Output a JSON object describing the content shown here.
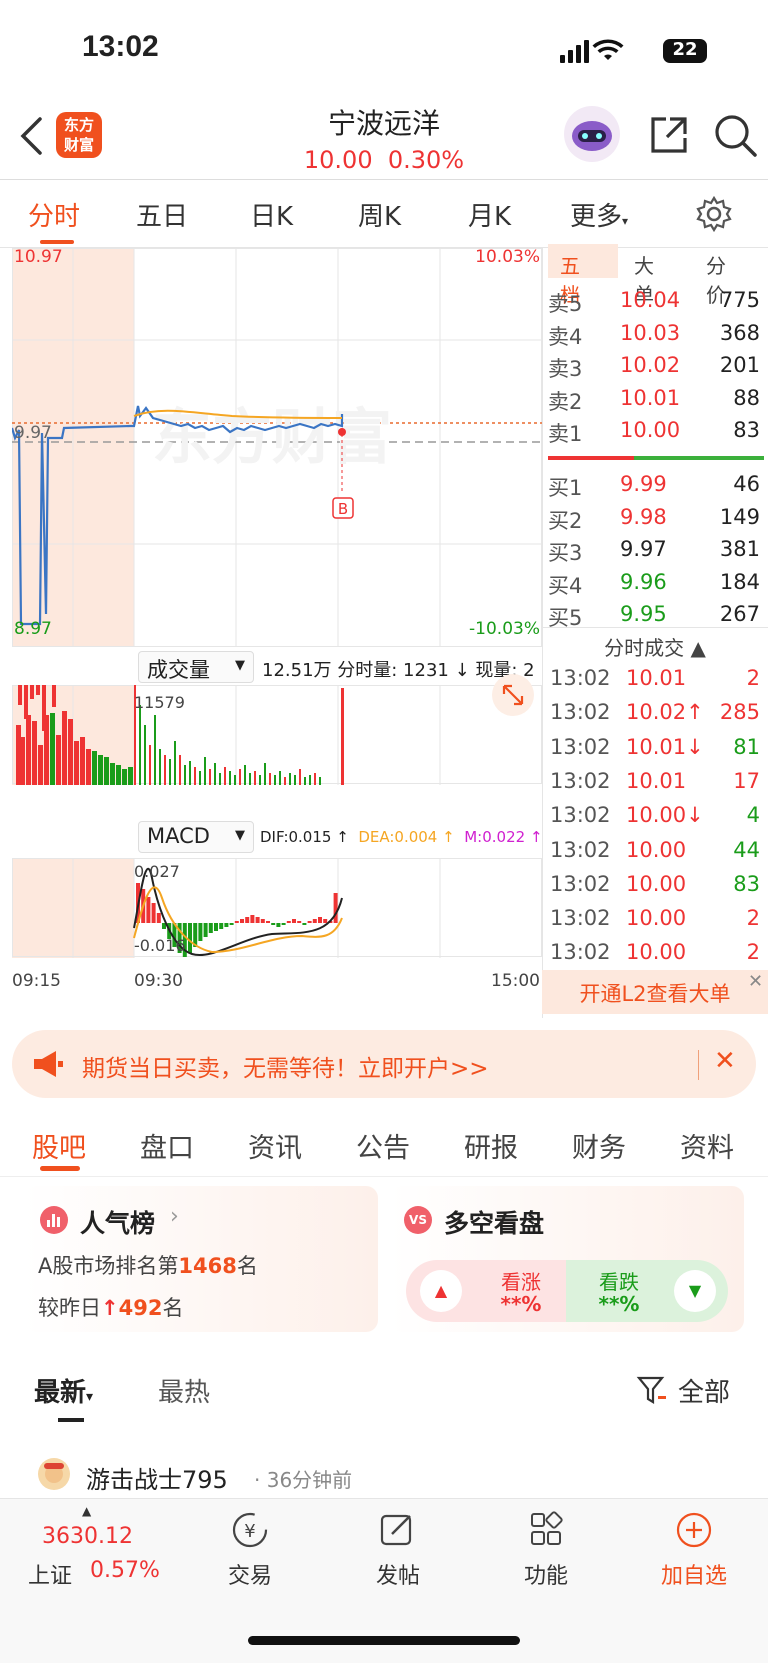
{
  "status": {
    "time": "13:02",
    "battery": "22"
  },
  "header": {
    "logo_line1": "东方",
    "logo_line2": "财富",
    "title": "宁波远洋",
    "price": "10.00",
    "change": "0.30%"
  },
  "tabs": [
    "分时",
    "五日",
    "日K",
    "周K",
    "月K",
    "更多"
  ],
  "chart": {
    "high_label": "10.97",
    "high_pct": "10.03%",
    "mid_label": "9.97",
    "low_label": "8.97",
    "low_pct": "-10.03%",
    "marker": "B",
    "volume_selector": "成交量",
    "volume_info": "12.51万 分时量: 1231 ↓ 现量: 2",
    "volume_max": "11579",
    "macd_selector": "MACD",
    "macd_dif": "DIF:0.015 ↑",
    "macd_dea": "DEA:0.004 ↑",
    "macd_m": "M:0.022 ↑",
    "macd_top": "0.027",
    "macd_bottom": "-0.016",
    "time_start": "09:15",
    "time_open": "09:30",
    "time_end": "15:00",
    "colors": {
      "price": "#3b75c4",
      "avg": "#f5a623",
      "up": "#e33",
      "down": "#1a9c1a"
    }
  },
  "book": {
    "tabs": [
      "五档",
      "大单",
      "分价"
    ],
    "asks": [
      {
        "label": "卖5",
        "price": "10.04",
        "vol": "775"
      },
      {
        "label": "卖4",
        "price": "10.03",
        "vol": "368"
      },
      {
        "label": "卖3",
        "price": "10.02",
        "vol": "201"
      },
      {
        "label": "卖2",
        "price": "10.01",
        "vol": "88"
      },
      {
        "label": "卖1",
        "price": "10.00",
        "vol": "83"
      }
    ],
    "bids": [
      {
        "label": "买1",
        "price": "9.99",
        "vol": "46"
      },
      {
        "label": "买2",
        "price": "9.98",
        "vol": "149"
      },
      {
        "label": "买3",
        "price": "9.97",
        "vol": "381"
      },
      {
        "label": "买4",
        "price": "9.96",
        "vol": "184"
      },
      {
        "label": "买5",
        "price": "9.95",
        "vol": "267"
      }
    ],
    "trades_title": "分时成交 ▲",
    "trades": [
      {
        "t": "13:02",
        "p": "10.01",
        "v": "2",
        "pc": "red",
        "vc": "red"
      },
      {
        "t": "13:02",
        "p": "10.02↑",
        "v": "285",
        "pc": "red",
        "vc": "red"
      },
      {
        "t": "13:02",
        "p": "10.01↓",
        "v": "81",
        "pc": "red",
        "vc": "green"
      },
      {
        "t": "13:02",
        "p": "10.01",
        "v": "17",
        "pc": "red",
        "vc": "red"
      },
      {
        "t": "13:02",
        "p": "10.00↓",
        "v": "4",
        "pc": "red",
        "vc": "green"
      },
      {
        "t": "13:02",
        "p": "10.00",
        "v": "44",
        "pc": "red",
        "vc": "green"
      },
      {
        "t": "13:02",
        "p": "10.00",
        "v": "83",
        "pc": "red",
        "vc": "green"
      },
      {
        "t": "13:02",
        "p": "10.00",
        "v": "2",
        "pc": "red",
        "vc": "red"
      },
      {
        "t": "13:02",
        "p": "10.00",
        "v": "2",
        "pc": "red",
        "vc": "red"
      }
    ],
    "l2_banner": "开通L2查看大单"
  },
  "promo": {
    "text": "期货当日买卖，无需等待！立即开户>>"
  },
  "subtabs": [
    "股吧",
    "盘口",
    "资讯",
    "公告",
    "研报",
    "财务",
    "资料"
  ],
  "popularity": {
    "title": "人气榜",
    "line1_prefix": "A股市场排名第",
    "rank": "1468",
    "line1_suffix": "名",
    "line2_prefix": "较昨日",
    "delta": "492",
    "line2_suffix": "名"
  },
  "sentiment": {
    "title": "多空看盘",
    "bull_label": "看涨",
    "bull_value": "**%",
    "bear_label": "看跌",
    "bear_value": "**%"
  },
  "feed": {
    "tab_latest": "最新",
    "tab_hot": "最热",
    "filter": "全部"
  },
  "post": {
    "author": "游击战士795",
    "time": "36分钟前"
  },
  "bottom": {
    "index_value": "3630.12",
    "index_name": "上证",
    "index_change": "0.57%",
    "items": [
      "交易",
      "发帖",
      "功能",
      "加自选"
    ]
  }
}
